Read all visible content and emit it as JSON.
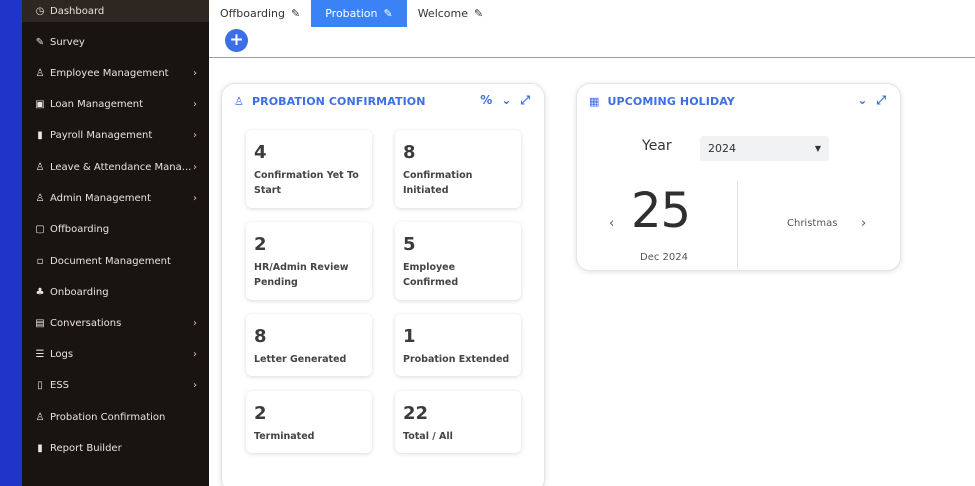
{
  "sidebar": {
    "items": [
      {
        "label": "Dashboard",
        "icon": "clock-icon",
        "glyph": "◷",
        "arrow": ""
      },
      {
        "label": "Survey",
        "icon": "edit-icon",
        "glyph": "✎",
        "arrow": ""
      },
      {
        "label": "Employee Management",
        "icon": "user-icon",
        "glyph": "♙",
        "arrow": "›"
      },
      {
        "label": "Loan Management",
        "icon": "briefcase-icon",
        "glyph": "▣",
        "arrow": "›"
      },
      {
        "label": "Payroll Management",
        "icon": "bar-chart-icon",
        "glyph": "▮",
        "arrow": "›"
      },
      {
        "label": "Leave & Attendance Mana...",
        "icon": "user-icon",
        "glyph": "♙",
        "arrow": "›"
      },
      {
        "label": "Admin Management",
        "icon": "user-icon",
        "glyph": "♙",
        "arrow": "›"
      },
      {
        "label": "Offboarding",
        "icon": "square-icon",
        "glyph": "▢",
        "arrow": ""
      },
      {
        "label": "Document Management",
        "icon": "document-icon",
        "glyph": "▫",
        "arrow": ""
      },
      {
        "label": "Onboarding",
        "icon": "team-icon",
        "glyph": "♣",
        "arrow": ""
      },
      {
        "label": "Conversations",
        "icon": "chat-icon",
        "glyph": "▤",
        "arrow": "›"
      },
      {
        "label": "Logs",
        "icon": "list-icon",
        "glyph": "☰",
        "arrow": "›"
      },
      {
        "label": "ESS",
        "icon": "book-icon",
        "glyph": "▯",
        "arrow": "›"
      },
      {
        "label": "Probation Confirmation",
        "icon": "user-icon",
        "glyph": "♙",
        "arrow": ""
      },
      {
        "label": "Report Builder",
        "icon": "bar-chart-icon",
        "glyph": "▮",
        "arrow": ""
      }
    ]
  },
  "tabs": [
    {
      "label": "Offboarding",
      "edit": "✎",
      "active": false
    },
    {
      "label": "Probation",
      "edit": "✎",
      "active": true
    },
    {
      "label": "Welcome",
      "edit": "✎",
      "active": false
    }
  ],
  "add_button": "+",
  "probation": {
    "title": "PROBATION CONFIRMATION",
    "icon": "user-icon",
    "tools": [
      "link-icon",
      "chevron-down-icon",
      "expand-icon"
    ],
    "stats": [
      {
        "number": "4",
        "caption": "Confirmation Yet To Start"
      },
      {
        "number": "8",
        "caption": "Confirmation Initiated"
      },
      {
        "number": "2",
        "caption": "HR/Admin Review Pending"
      },
      {
        "number": "5",
        "caption": "Employee Confirmed"
      },
      {
        "number": "8",
        "caption": "Letter Generated"
      },
      {
        "number": "1",
        "caption": "Probation Extended"
      },
      {
        "number": "2",
        "caption": "Terminated"
      },
      {
        "number": "22",
        "caption": "Total / All"
      }
    ]
  },
  "holiday": {
    "title": "UPCOMING HOLIDAY",
    "icon": "calendar-icon",
    "year_label": "Year",
    "year_value": "2024",
    "day": "25",
    "month": "Dec 2024",
    "name": "Christmas",
    "prev": "‹",
    "next": "›"
  },
  "colors": {
    "accent": "#3b6fe5",
    "sidebar_bg": "#1a1410",
    "frame": "#1f34c9",
    "active_tab": "#3b82f6"
  }
}
